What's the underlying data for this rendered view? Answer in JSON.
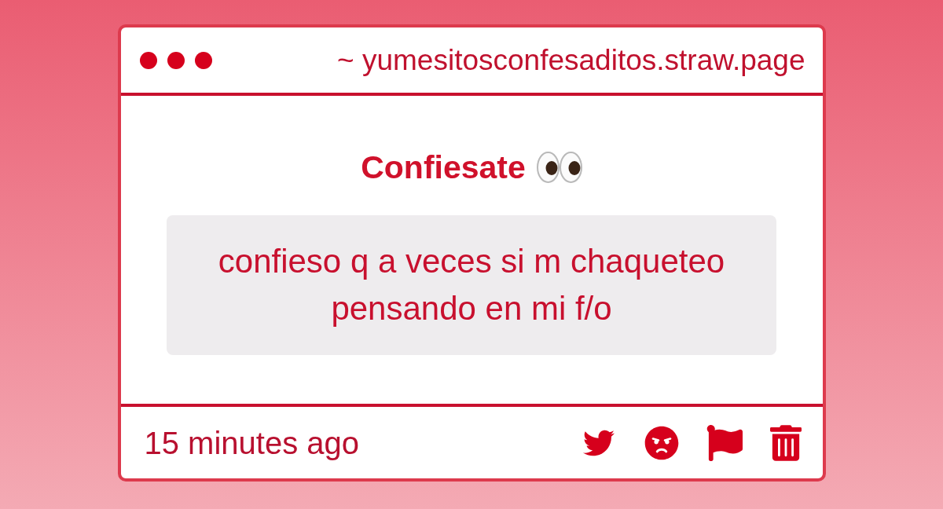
{
  "window": {
    "address": "~ yumesitosconfesaditos.straw.page"
  },
  "prompt": {
    "title": "Confiesate"
  },
  "message": {
    "text": "confieso q a veces si m chaqueteo pensando en mi f/o"
  },
  "footer": {
    "time": "15 minutes ago"
  }
}
